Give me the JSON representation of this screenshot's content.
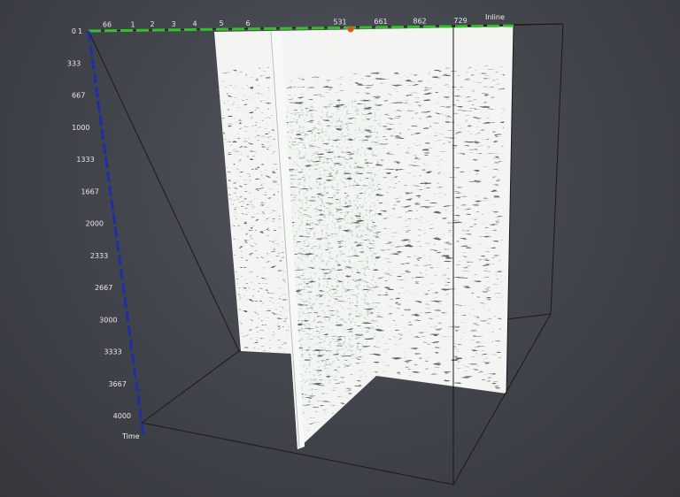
{
  "viewer": {
    "axes": {
      "time": {
        "title": "Time",
        "color": "#1f2ea8",
        "ticks": [
          "0",
          "333",
          "667",
          "1000",
          "1333",
          "1667",
          "2000",
          "2333",
          "2667",
          "3000",
          "3333",
          "3667",
          "4000"
        ]
      },
      "inline": {
        "title": "Inline",
        "color": "#34c02a",
        "origin_label": "1",
        "ticks": [
          "66",
          "1",
          "2",
          "3",
          "4",
          "5",
          "6",
          "531",
          "661",
          "862",
          "729"
        ]
      }
    },
    "slices": {
      "background_color": "#f4f4f2",
      "noise_color": "#2a2a2a",
      "highlight_color": "#3fa85a"
    },
    "markers": {
      "cursor_color": "#d85a1a"
    },
    "frame_color": "#1a1a1d"
  }
}
